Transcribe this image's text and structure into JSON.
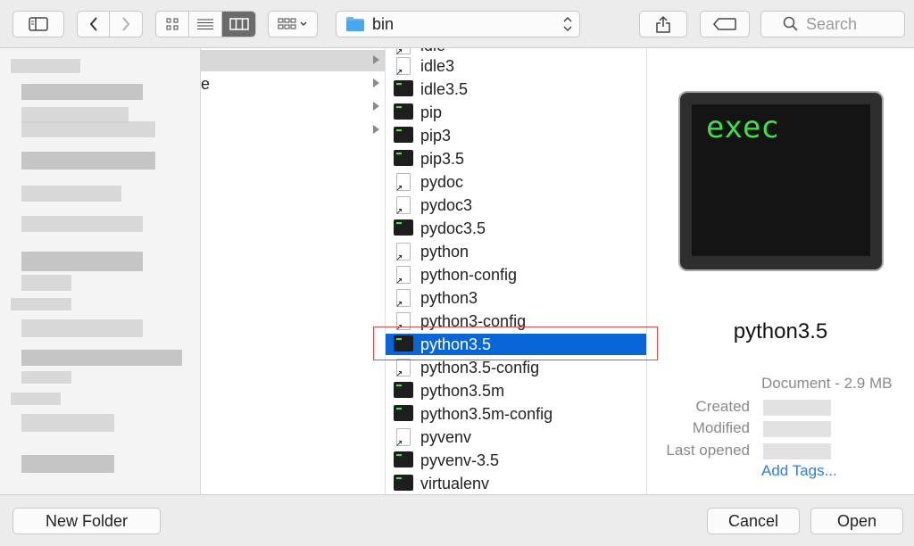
{
  "toolbar": {
    "sidebar_toggle_icon": "sidebar-icon",
    "back_icon": "chevron-left-icon",
    "forward_icon": "chevron-right-icon",
    "view_modes": [
      "icon-view",
      "list-view",
      "column-view"
    ],
    "active_view": "column-view",
    "arrange_icon": "arrange-icon",
    "location": "bin",
    "share_icon": "share-icon",
    "tag_icon": "tag-icon",
    "search_placeholder": "Search"
  },
  "column1": {
    "partial_text": "e"
  },
  "files": [
    {
      "name": "idle3",
      "kind": "alias"
    },
    {
      "name": "idle3.5",
      "kind": "exec"
    },
    {
      "name": "pip",
      "kind": "exec"
    },
    {
      "name": "pip3",
      "kind": "exec"
    },
    {
      "name": "pip3.5",
      "kind": "exec"
    },
    {
      "name": "pydoc",
      "kind": "alias"
    },
    {
      "name": "pydoc3",
      "kind": "alias"
    },
    {
      "name": "pydoc3.5",
      "kind": "exec"
    },
    {
      "name": "python",
      "kind": "alias"
    },
    {
      "name": "python-config",
      "kind": "alias"
    },
    {
      "name": "python3",
      "kind": "alias"
    },
    {
      "name": "python3-config",
      "kind": "alias"
    },
    {
      "name": "python3.5",
      "kind": "exec",
      "selected": true
    },
    {
      "name": "python3.5-config",
      "kind": "alias"
    },
    {
      "name": "python3.5m",
      "kind": "exec"
    },
    {
      "name": "python3.5m-config",
      "kind": "exec"
    },
    {
      "name": "pyvenv",
      "kind": "alias"
    },
    {
      "name": "pyvenv-3.5",
      "kind": "exec"
    },
    {
      "name": "virtualenv",
      "kind": "exec"
    }
  ],
  "partial_top_file": "idle",
  "preview": {
    "icon_text": "exec",
    "name": "python3.5",
    "kind": "Document - 2.9 MB",
    "created_label": "Created",
    "modified_label": "Modified",
    "last_opened_label": "Last opened",
    "add_tags": "Add Tags..."
  },
  "bottom": {
    "new_folder": "New Folder",
    "cancel": "Cancel",
    "open": "Open"
  },
  "colors": {
    "selection": "#0966d9",
    "accent_link": "#2f7ee8",
    "exec_green": "#3ee04a"
  }
}
